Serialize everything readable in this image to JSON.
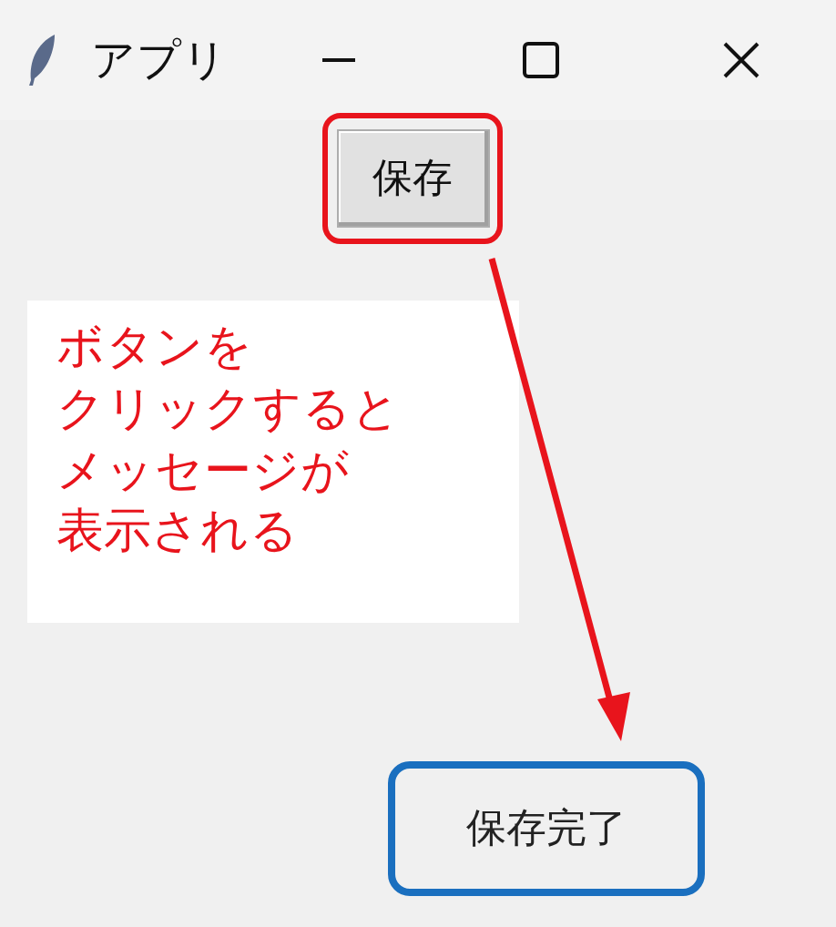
{
  "window": {
    "title": "アプリ"
  },
  "save_button": {
    "label": "保存"
  },
  "annotation": {
    "lines": [
      "ボタンを",
      "クリックすると",
      "メッセージが",
      "表示される"
    ]
  },
  "message_label": {
    "text": "保存完了"
  }
}
